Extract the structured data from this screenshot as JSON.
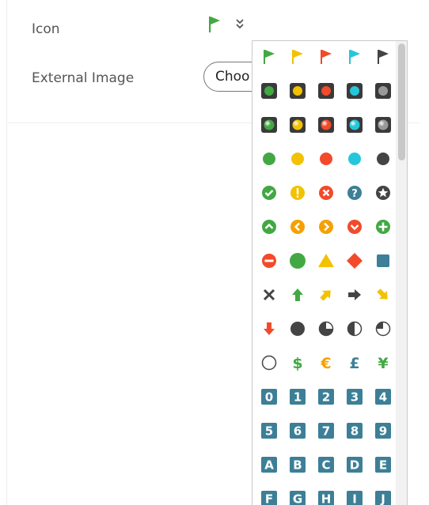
{
  "form": {
    "icon_label": "Icon",
    "external_image_label": "External Image",
    "choose_button_label": "Choo",
    "selected_icon": "green-flag-icon"
  },
  "colors": {
    "green": "#43a843",
    "yellow": "#f2c200",
    "orange": "#f5a000",
    "red": "#f24a2a",
    "cyan": "#26c6da",
    "dark": "#444444",
    "gray": "#999999",
    "tile": "#3c7f96"
  },
  "icon_grid": [
    [
      "green-flag-icon",
      "yellow-flag-icon",
      "red-flag-icon",
      "cyan-flag-icon",
      "black-flag-icon"
    ],
    [
      "green-traffic-light-icon",
      "yellow-traffic-light-icon",
      "red-traffic-light-icon",
      "cyan-traffic-light-icon",
      "gray-traffic-light-icon"
    ],
    [
      "green-glossy-light-icon",
      "yellow-glossy-light-icon",
      "red-glossy-light-icon",
      "cyan-glossy-light-icon",
      "gray-glossy-light-icon"
    ],
    [
      "green-circle-icon",
      "yellow-circle-icon",
      "red-circle-icon",
      "cyan-circle-icon",
      "black-circle-icon"
    ],
    [
      "check-circle-icon",
      "exclamation-circle-icon",
      "x-circle-icon",
      "question-circle-icon",
      "star-circle-icon"
    ],
    [
      "chevron-up-circle-icon",
      "chevron-left-circle-icon",
      "chevron-right-circle-icon",
      "chevron-down-circle-icon",
      "plus-circle-icon"
    ],
    [
      "minus-circle-icon",
      "green-circle-large-icon",
      "yellow-triangle-icon",
      "red-diamond-icon",
      "blue-square-icon"
    ],
    [
      "x-mark-icon",
      "green-arrow-up-icon",
      "yellow-arrow-up-right-icon",
      "dark-arrow-right-icon",
      "yellow-arrow-down-right-icon"
    ],
    [
      "red-arrow-down-icon",
      "full-circle-icon",
      "three-quarter-circle-icon",
      "half-circle-icon",
      "quarter-circle-icon"
    ],
    [
      "empty-circle-icon",
      "dollar-icon",
      "euro-icon",
      "pound-icon",
      "yen-icon"
    ],
    [
      "number-0-icon",
      "number-1-icon",
      "number-2-icon",
      "number-3-icon",
      "number-4-icon"
    ],
    [
      "number-5-icon",
      "number-6-icon",
      "number-7-icon",
      "number-8-icon",
      "number-9-icon"
    ],
    [
      "letter-a-icon",
      "letter-b-icon",
      "letter-c-icon",
      "letter-d-icon",
      "letter-e-icon"
    ],
    [
      "letter-f-icon",
      "letter-g-icon",
      "letter-h-icon",
      "letter-i-icon",
      "letter-j-icon"
    ]
  ],
  "symbols": {
    "dollar": "$",
    "euro": "€",
    "pound": "£",
    "yen": "¥",
    "digits": [
      "0",
      "1",
      "2",
      "3",
      "4",
      "5",
      "6",
      "7",
      "8",
      "9"
    ],
    "letters": [
      "A",
      "B",
      "C",
      "D",
      "E",
      "F",
      "G",
      "H",
      "I",
      "J"
    ]
  }
}
